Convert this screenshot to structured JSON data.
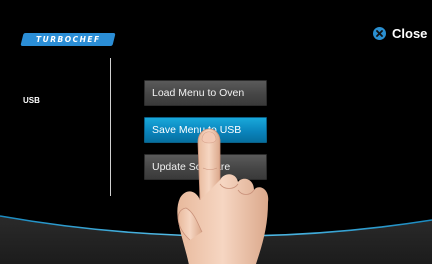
{
  "header": {
    "logo_text": "TURBOCHEF",
    "close_label": "Close",
    "close_icon": "close-circle-icon",
    "accent": "#2a8fd0"
  },
  "sidebar": {
    "label": "USB"
  },
  "menu": {
    "items": [
      {
        "label": "Load Menu to Oven",
        "active": false
      },
      {
        "label": "Save Menu to USB",
        "active": true
      },
      {
        "label": "Update Software",
        "active": false
      }
    ]
  },
  "overlay": {
    "hand": "pointing-hand"
  },
  "colors": {
    "background": "#000000",
    "active_button": "#0a85bd",
    "button": "#4a4a4a",
    "wave": "#1c8fc4"
  }
}
